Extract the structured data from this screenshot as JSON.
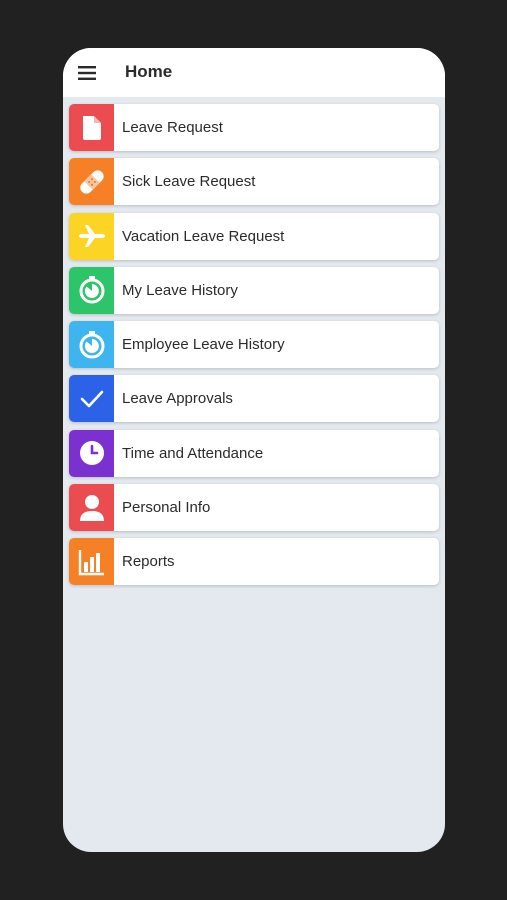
{
  "header": {
    "title": "Home",
    "menu_icon": "hamburger-menu-icon"
  },
  "items": [
    {
      "label": "Leave Request",
      "icon": "document-icon",
      "color": "#ea4c4f"
    },
    {
      "label": "Sick Leave Request",
      "icon": "bandage-icon",
      "color": "#f68026"
    },
    {
      "label": "Vacation Leave Request",
      "icon": "airplane-icon",
      "color": "#fbd424"
    },
    {
      "label": "My Leave History",
      "icon": "stopwatch-icon",
      "color": "#2ec46a"
    },
    {
      "label": "Employee Leave History",
      "icon": "stopwatch-icon",
      "color": "#3fb5ef"
    },
    {
      "label": "Leave Approvals",
      "icon": "checkmark-icon",
      "color": "#2c62e8"
    },
    {
      "label": "Time and Attendance",
      "icon": "clock-icon",
      "color": "#7b30d0"
    },
    {
      "label": "Personal Info",
      "icon": "person-icon",
      "color": "#ea4c4f"
    },
    {
      "label": "Reports",
      "icon": "bar-chart-icon",
      "color": "#f68026"
    }
  ]
}
